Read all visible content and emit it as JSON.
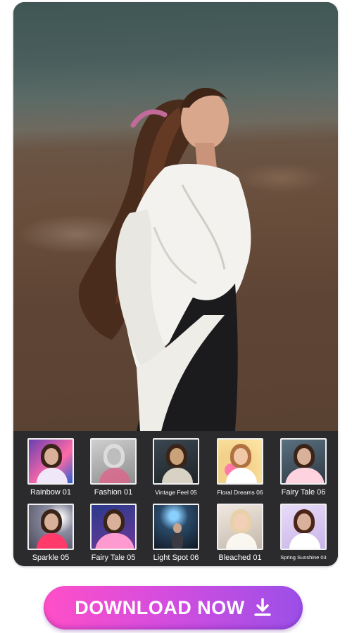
{
  "filters": [
    {
      "label": "Rainbow 01",
      "bg": "#7a4fb0",
      "accent": "#ff6aa8"
    },
    {
      "label": "Fashion 01",
      "bg": "#b8b8b8",
      "accent": "#e85d8a"
    },
    {
      "label": "Vintage Feel 05",
      "bg": "#2f3a40",
      "accent": "#c9a27a"
    },
    {
      "label": "Floral Dreams 06",
      "bg": "#f2d28a",
      "accent": "#ff7aa8"
    },
    {
      "label": "Fairy Tale 06",
      "bg": "#4a5f70",
      "accent": "#ffd2e0"
    },
    {
      "label": "Sparkle 05",
      "bg": "#6a6a7a",
      "accent": "#ff3a6a"
    },
    {
      "label": "Fairy Tale 05",
      "bg": "#3a3a7a",
      "accent": "#ff9ad0"
    },
    {
      "label": "Light Spot 06",
      "bg": "#1e2a3a",
      "accent": "#8ad0ff"
    },
    {
      "label": "Bleached 01",
      "bg": "#d9cfc4",
      "accent": "#e8d0a8"
    },
    {
      "label": "Spring Sunshine 03",
      "bg": "#d8c8f0",
      "accent": "#b04050"
    }
  ],
  "download": {
    "label": "DOWNLOAD NOW",
    "icon": "download-arrow-icon"
  },
  "colors": {
    "panel": "#2b2b2e",
    "button_start": "#ff4fc7",
    "button_end": "#9b4fe8"
  }
}
